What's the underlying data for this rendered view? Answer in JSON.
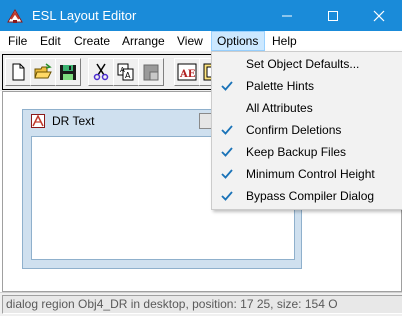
{
  "window": {
    "title": "ESL Layout Editor",
    "accent_color": "#1a8bd9",
    "controls": [
      "minimize-icon",
      "maximize-icon",
      "close-icon"
    ]
  },
  "menubar": {
    "items": [
      {
        "label": "File"
      },
      {
        "label": "Edit"
      },
      {
        "label": "Create"
      },
      {
        "label": "Arrange"
      },
      {
        "label": "View"
      },
      {
        "label": "Options",
        "active": true
      },
      {
        "label": "Help"
      }
    ]
  },
  "toolbar": {
    "buttons": [
      {
        "icon": "new-file-icon"
      },
      {
        "icon": "open-folder-icon"
      },
      {
        "icon": "save-disk-icon"
      },
      {
        "icon": "cut-scissors-icon"
      },
      {
        "icon": "copy-icon"
      },
      {
        "icon": "paste-icon",
        "disabled": true
      },
      {
        "icon": "text-tool-icon",
        "text": "AE"
      },
      {
        "icon": "palette-icon"
      }
    ]
  },
  "region": {
    "title": "DR Text",
    "icon": "region-icon"
  },
  "options_menu": {
    "items": [
      {
        "label": "Set Object Defaults...",
        "checked": false
      },
      {
        "label": "Palette Hints",
        "checked": true
      },
      {
        "label": "All Attributes",
        "checked": false
      },
      {
        "label": "Confirm Deletions",
        "checked": true
      },
      {
        "label": "Keep Backup Files",
        "checked": true
      },
      {
        "label": "Minimum Control Height",
        "checked": true
      },
      {
        "label": "Bypass Compiler Dialog",
        "checked": true
      }
    ]
  },
  "status": {
    "text": "dialog region Obj4_DR in desktop, position: 17 25, size: 154 O"
  }
}
